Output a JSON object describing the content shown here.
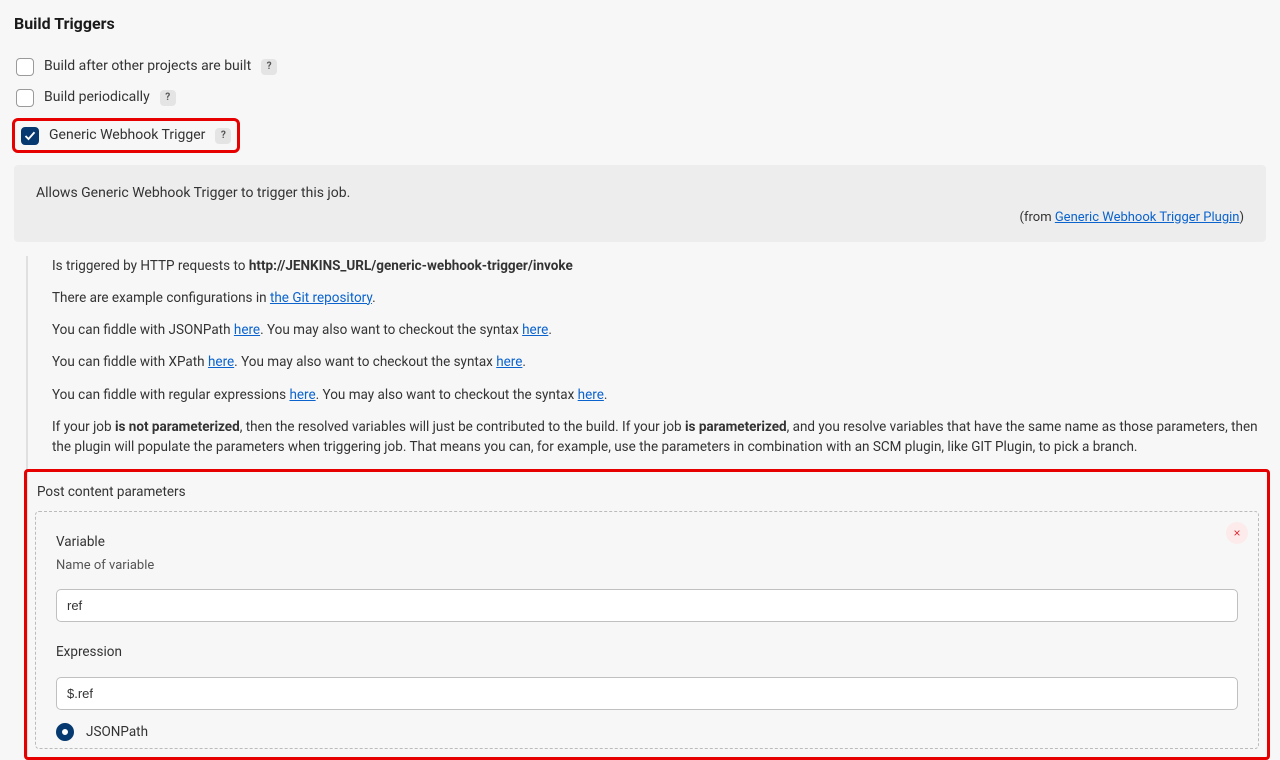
{
  "header": "Build Triggers",
  "triggers": {
    "build_after": "Build after other projects are built",
    "build_periodically": "Build periodically",
    "generic_webhook": "Generic Webhook Trigger"
  },
  "help_symbol": "?",
  "info_panel": {
    "text": "Allows Generic Webhook Trigger to trigger this job.",
    "from_prefix": "(from ",
    "from_link": "Generic Webhook Trigger Plugin",
    "from_suffix": ")"
  },
  "desc": {
    "p1_a": "Is triggered by HTTP requests to ",
    "p1_b": "http://JENKINS_URL/generic-webhook-trigger/invoke",
    "p2_a": "There are example configurations in ",
    "p2_link": "the Git repository",
    "p2_b": ".",
    "p3_a": "You can fiddle with JSONPath ",
    "p3_link1": "here",
    "p3_b": ". You may also want to checkout the syntax ",
    "p3_link2": "here",
    "p3_c": ".",
    "p4_a": "You can fiddle with XPath ",
    "p4_link1": "here",
    "p4_b": ". You may also want to checkout the syntax ",
    "p4_link2": "here",
    "p4_c": ".",
    "p5_a": "You can fiddle with regular expressions ",
    "p5_link1": "here",
    "p5_b": ". You may also want to checkout the syntax ",
    "p5_link2": "here",
    "p5_c": ".",
    "p6_a": "If your job ",
    "p6_b": "is not parameterized",
    "p6_c": ", then the resolved variables will just be contributed to the build. If your job ",
    "p6_d": "is parameterized",
    "p6_e": ", and you resolve variables that have the same name as those parameters, then the plugin will populate the parameters when triggering job. That means you can, for example, use the parameters in combination with an SCM plugin, like GIT Plugin, to pick a branch."
  },
  "pcp": {
    "title": "Post content parameters",
    "variable_label": "Variable",
    "variable_sublabel": "Name of variable",
    "variable_value": "ref",
    "expression_label": "Expression",
    "expression_value": "$.ref",
    "jsonpath_label": "JSONPath",
    "remove": "×"
  }
}
